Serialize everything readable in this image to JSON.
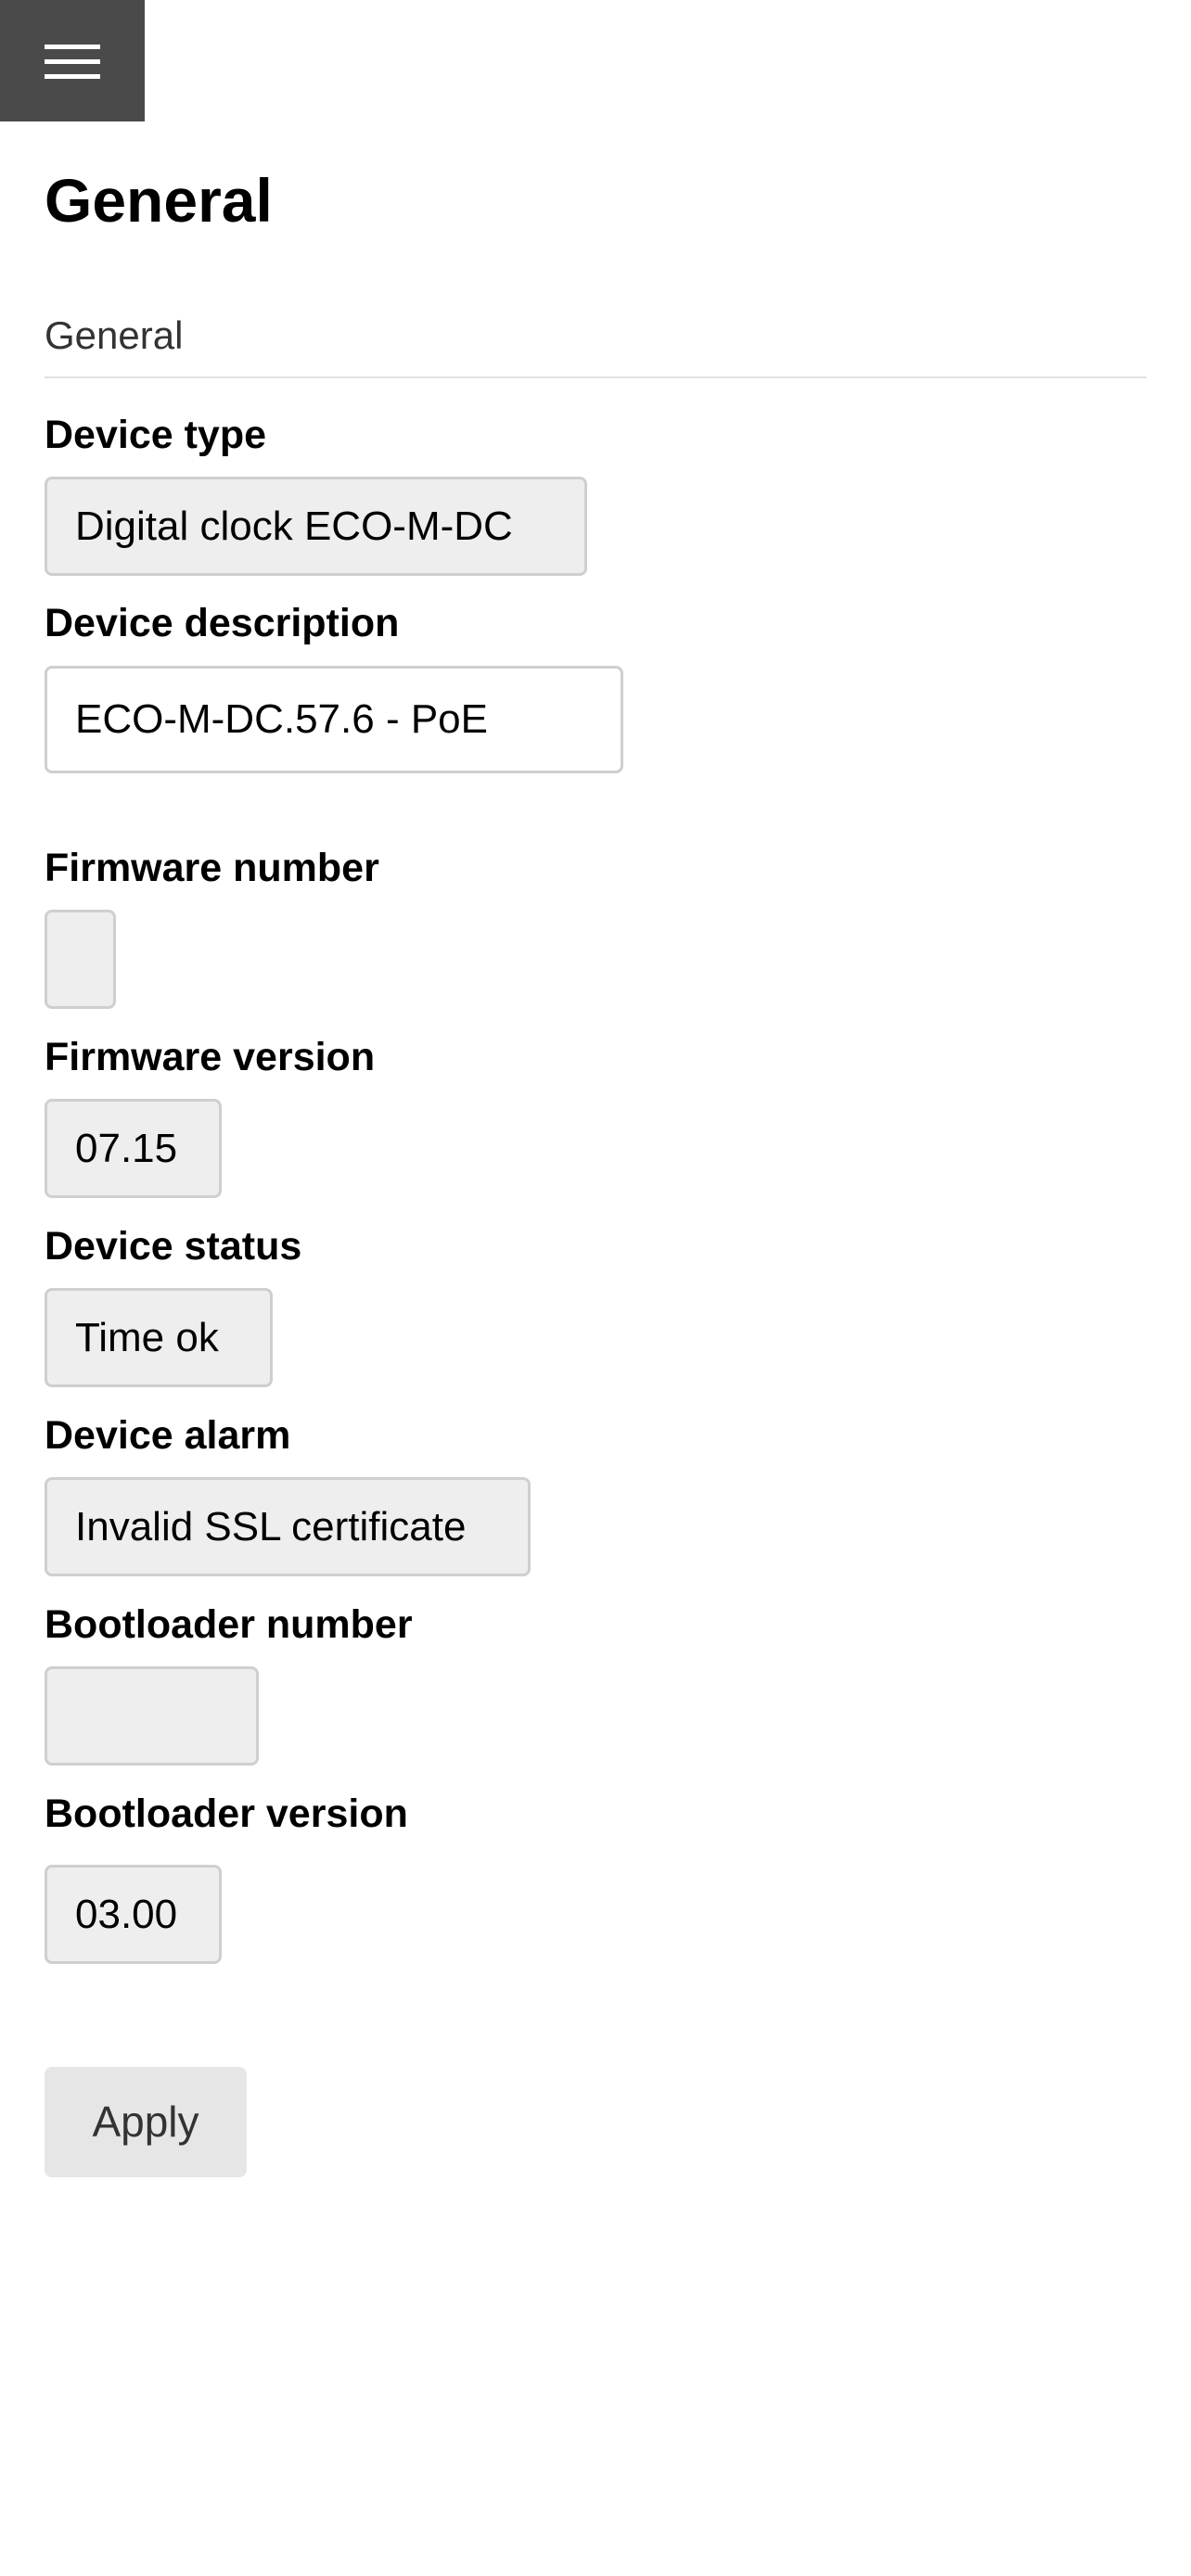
{
  "header": {
    "menu_icon": "hamburger-menu-icon"
  },
  "page_title": "General",
  "section_title": "General",
  "fields": [
    {
      "label": "Device type",
      "value": "Digital clock ECO-M-DC",
      "editable": false
    },
    {
      "label": "Device description",
      "value": "ECO-M-DC.57.6 - PoE",
      "editable": true
    },
    {
      "label": "Firmware number",
      "value": "",
      "editable": false
    },
    {
      "label": "Firmware version",
      "value": "07.15",
      "editable": false
    },
    {
      "label": "Device status",
      "value": "Time ok",
      "editable": false
    },
    {
      "label": "Device alarm",
      "value": "Invalid SSL certificate",
      "editable": false
    },
    {
      "label": "Bootloader number",
      "value": "",
      "editable": false
    },
    {
      "label": "Bootloader version",
      "value": "03.00",
      "editable": false
    }
  ],
  "apply_label": "Apply"
}
